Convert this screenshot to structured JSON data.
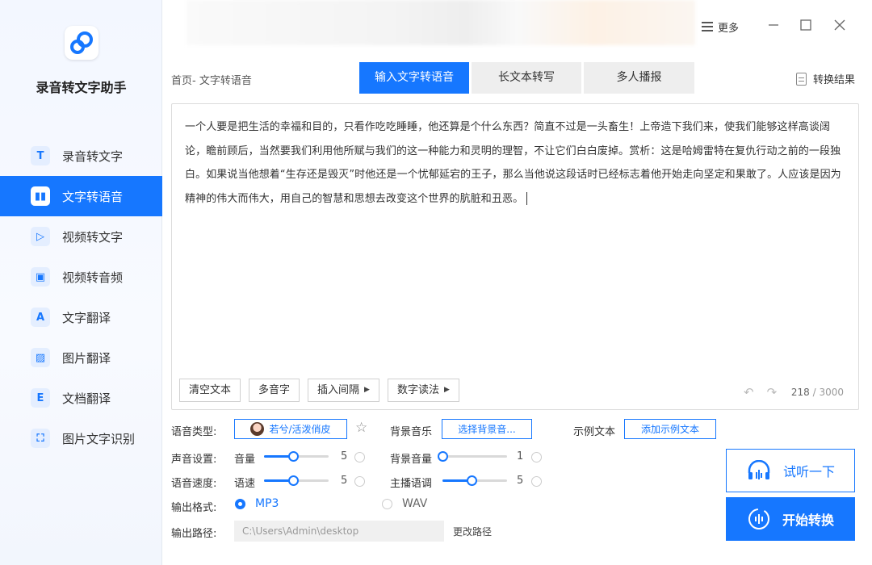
{
  "app": {
    "name": "录音转文字助手"
  },
  "sidebar": {
    "items": [
      {
        "label": "录音转文字",
        "icon": "T"
      },
      {
        "label": "文字转语音",
        "icon": "▮▮",
        "active": true
      },
      {
        "label": "视频转文字",
        "icon": "▷"
      },
      {
        "label": "视频转音频",
        "icon": "▣"
      },
      {
        "label": "文字翻译",
        "icon": "A"
      },
      {
        "label": "图片翻译",
        "icon": "▨"
      },
      {
        "label": "文档翻译",
        "icon": "E"
      },
      {
        "label": "图片文字识别",
        "icon": "⛶"
      }
    ]
  },
  "titlebar": {
    "more_label": "更多"
  },
  "breadcrumb": "首页- 文字转语音",
  "tabs": [
    {
      "label": "输入文字转语音",
      "active": true
    },
    {
      "label": "长文本转写"
    },
    {
      "label": "多人播报"
    }
  ],
  "result_label": "转换结果",
  "editor": {
    "text": "一个人要是把生活的幸福和目的，只看作吃吃睡睡，他还算是个什么东西？简直不过是一头畜生！上帝造下我们来，使我们能够这样高谈阔论，瞻前顾后，当然要我们利用他所赋与我们的这一种能力和灵明的理智，不让它们白白废掉。赏析：这是哈姆雷特在复仇行动之前的一段独白。如果说当他想着“生存还是毁灭”时他还是一个忧郁延宕的王子，那么当他说这段话时已经标志着他开始走向坚定和果敢了。人应该是因为精神的伟大而伟大，用自己的智慧和思想去改变这个世界的肮脏和丑恶。",
    "tools": [
      "清空文本",
      "多音字",
      "插入间隔",
      "数字读法"
    ],
    "count": "218",
    "max": "/ 3000"
  },
  "settings": {
    "voice_type_label": "语音类型:",
    "voice_name": "若兮/活泼俏皮",
    "bgm_label": "背景音乐",
    "bgm_button": "选择背景音...",
    "sample_label": "示例文本",
    "sample_button": "添加示例文本",
    "sound_label": "声音设置:",
    "volume_label": "音量",
    "volume_value": "5",
    "bg_volume_label": "背景音量",
    "bg_volume_value": "1",
    "speed_label": "语音速度:",
    "rate_label": "语速",
    "rate_value": "5",
    "pitch_label": "主播语调",
    "pitch_value": "5",
    "format_label": "输出格式:",
    "format_mp3": "MP3",
    "format_wav": "WAV",
    "path_label": "输出路径:",
    "path_value": "C:\\Users\\Admin\\desktop",
    "change_path": "更改路径"
  },
  "actions": {
    "listen": "试听一下",
    "start": "开始转换"
  },
  "colors": {
    "accent": "#1677ff"
  }
}
